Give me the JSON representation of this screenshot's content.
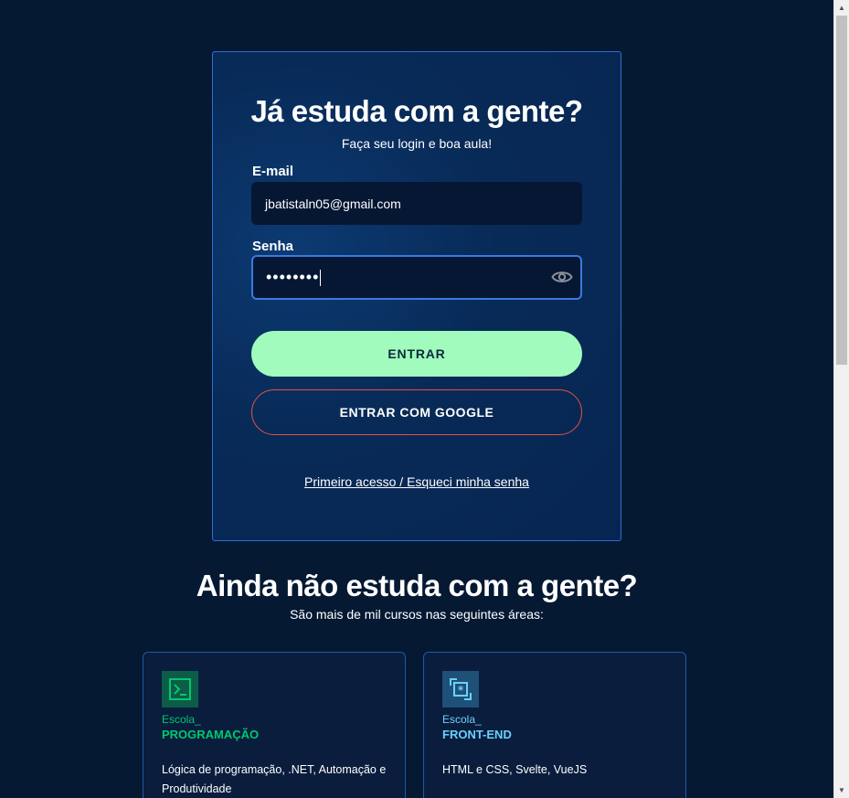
{
  "login": {
    "title": "Já estuda com a gente?",
    "subtitle": "Faça seu login e boa aula!",
    "email_label": "E-mail",
    "email_value": "jbatistaln05@gmail.com",
    "password_label": "Senha",
    "password_value": "••••••••",
    "enter_button": "ENTRAR",
    "google_button": "ENTRAR COM GOOGLE",
    "recover_link": "Primeiro acesso / Esqueci minha senha"
  },
  "signup": {
    "title": "Ainda não estuda com a gente?",
    "subtitle": "São mais de mil cursos nas seguintes áreas:"
  },
  "schools": [
    {
      "prefix": "Escola_",
      "name": "PROGRAMAÇÃO",
      "description": "Lógica de programação, .NET, Automação e Produtividade",
      "icon": "terminal-icon",
      "accent": "#00c86f",
      "icon_bg": "#0c5c48"
    },
    {
      "prefix": "Escola_",
      "name": "FRONT-END",
      "description": "HTML e CSS, Svelte, VueJS",
      "icon": "frontend-icon",
      "accent": "#6bd1ff",
      "icon_bg": "#1f5077"
    }
  ],
  "colors": {
    "background": "#051933",
    "primary_button": "#a0fbbd",
    "google_border": "#e0533f",
    "card_border": "#2a6fd1"
  }
}
